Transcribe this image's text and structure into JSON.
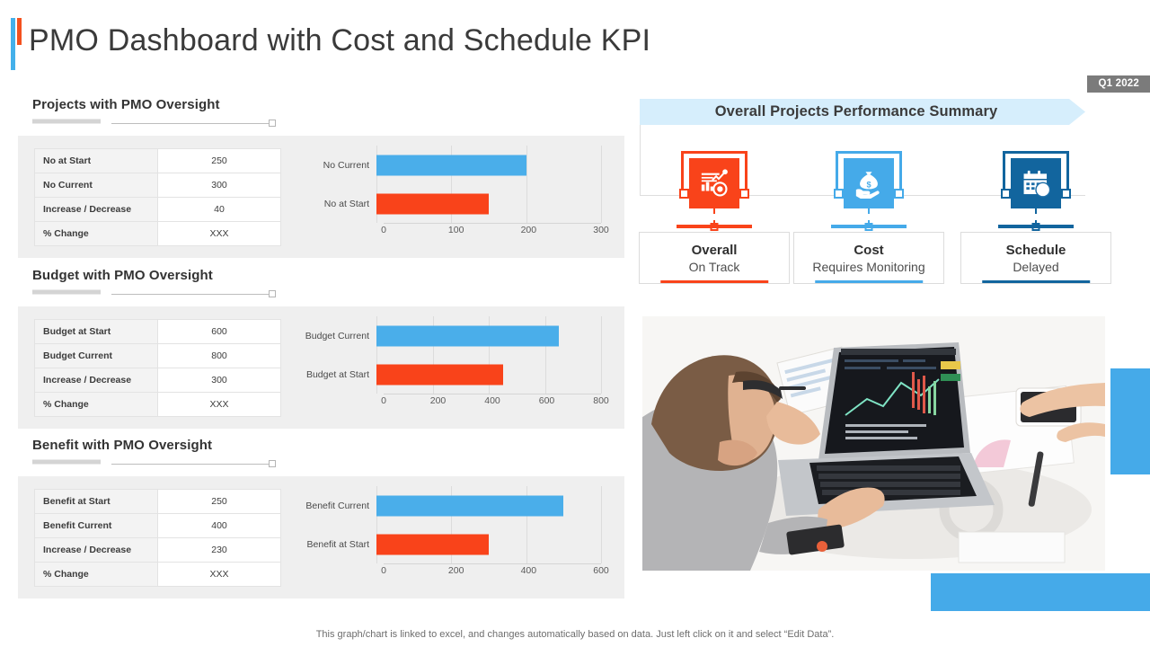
{
  "title": "PMO Dashboard with Cost and Schedule KPI",
  "quarter_badge": "Q1 2022",
  "banner_title": "Overall Projects Performance Summary",
  "footer_note": "This graph/chart is linked to excel,  and changes automatically based on data. Just left click on it and select “Edit Data”.",
  "colors": {
    "blue": "#4aaeea",
    "orange": "#f9431a",
    "dark_blue": "#12659e",
    "badge_gray": "#7b7b7b",
    "banner_bg": "#d6eefc",
    "panel_bg": "#efefef"
  },
  "sections": [
    {
      "heading": "Projects with PMO Oversight",
      "table": {
        "rows": [
          {
            "label": "No at Start",
            "value": "250"
          },
          {
            "label": "No Current",
            "value": "300"
          },
          {
            "label": "Increase / Decrease",
            "value": "40"
          },
          {
            "label": "% Change",
            "value": "XXX"
          }
        ]
      }
    },
    {
      "heading": "Budget with PMO Oversight",
      "table": {
        "rows": [
          {
            "label": "Budget at Start",
            "value": "600"
          },
          {
            "label": "Budget Current",
            "value": "800"
          },
          {
            "label": "Increase / Decrease",
            "value": "300"
          },
          {
            "label": "% Change",
            "value": "XXX"
          }
        ]
      }
    },
    {
      "heading": "Benefit with PMO Oversight",
      "table": {
        "rows": [
          {
            "label": "Benefit at Start",
            "value": "250"
          },
          {
            "label": "Benefit Current",
            "value": "400"
          },
          {
            "label": "Increase / Decrease",
            "value": "230"
          },
          {
            "label": "% Change",
            "value": "XXX"
          }
        ]
      }
    }
  ],
  "status_items": [
    {
      "icon": "performance-chart-target-icon",
      "title": "Overall",
      "subtitle": "On Track",
      "color": "#f9431a"
    },
    {
      "icon": "money-bag-hand-icon",
      "title": "Cost",
      "subtitle": "Requires Monitoring",
      "color": "#45aae9"
    },
    {
      "icon": "calendar-clock-icon",
      "title": "Schedule",
      "subtitle": "Delayed",
      "color": "#12659e"
    }
  ],
  "chart_data": [
    {
      "type": "bar",
      "title": "Projects with PMO Oversight",
      "orientation": "horizontal",
      "categories": [
        "No Current",
        "No at Start"
      ],
      "values": [
        200,
        150
      ],
      "colors": [
        "#4aaeea",
        "#f9431a"
      ],
      "xlabel": "",
      "ylabel": "",
      "xlim": [
        0,
        300
      ],
      "xticks": [
        0,
        100,
        200,
        300
      ],
      "tick_labels": [
        "0",
        "100",
        "200",
        "300"
      ],
      "grid": true,
      "legend": "none"
    },
    {
      "type": "bar",
      "title": "Budget with PMO Oversight",
      "orientation": "horizontal",
      "categories": [
        "Budget Current",
        "Budget at Start"
      ],
      "values": [
        650,
        450
      ],
      "colors": [
        "#4aaeea",
        "#f9431a"
      ],
      "xlabel": "",
      "ylabel": "",
      "xlim": [
        0,
        800
      ],
      "xticks": [
        0,
        200,
        400,
        600,
        800
      ],
      "tick_labels": [
        "0",
        "200",
        "400",
        "600",
        "800"
      ],
      "grid": true,
      "legend": "none"
    },
    {
      "type": "bar",
      "title": "Benefit with PMO Oversight",
      "orientation": "horizontal",
      "categories": [
        "Benefit  Current",
        "Benefit at Start"
      ],
      "values": [
        500,
        300
      ],
      "colors": [
        "#4aaeea",
        "#f9431a"
      ],
      "xlabel": "",
      "ylabel": "",
      "xlim": [
        0,
        600
      ],
      "xticks": [
        0,
        200,
        400,
        600
      ],
      "tick_labels": [
        "0",
        "200",
        "400",
        "600"
      ],
      "grid": true,
      "legend": "none"
    }
  ]
}
